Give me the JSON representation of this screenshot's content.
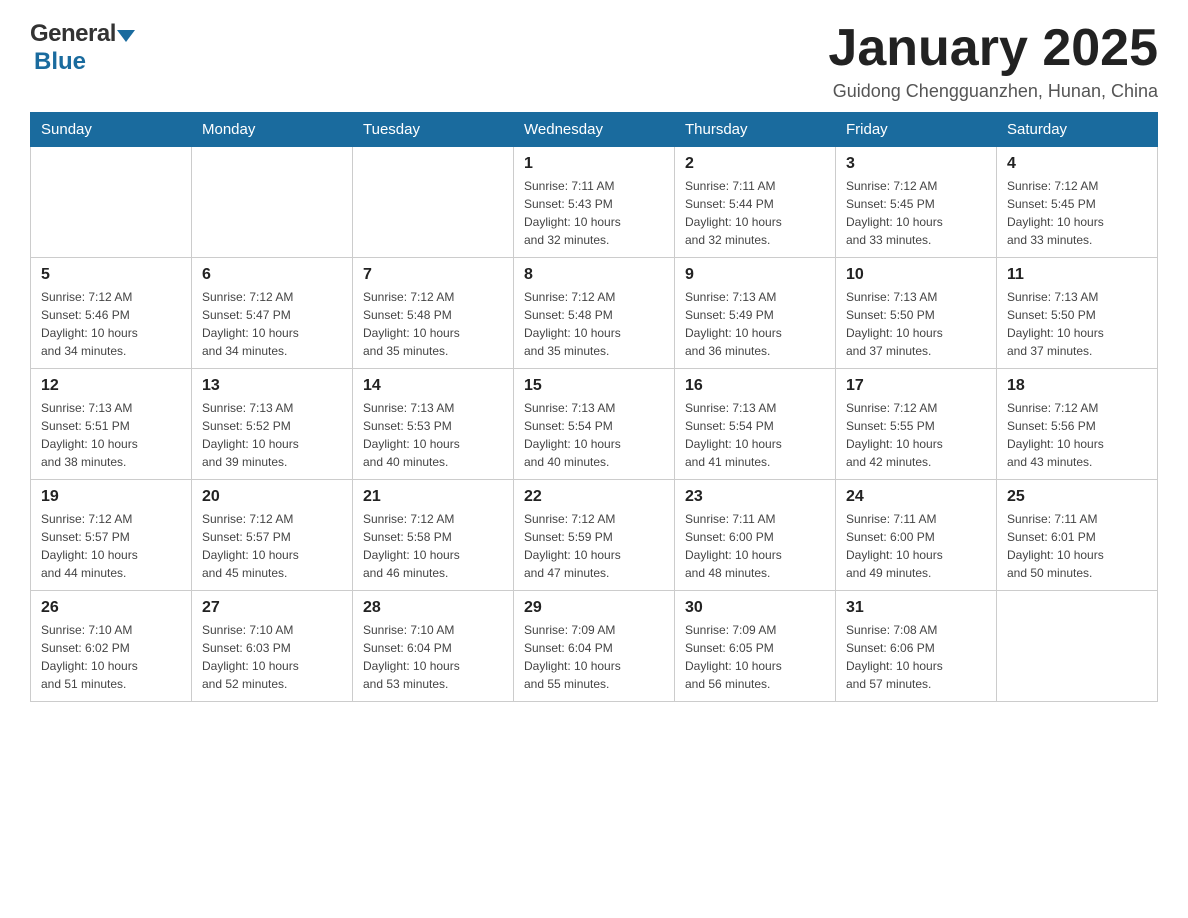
{
  "header": {
    "logo": {
      "general": "General",
      "blue": "Blue"
    },
    "title": "January 2025",
    "location": "Guidong Chengguanzhen, Hunan, China"
  },
  "days_of_week": [
    "Sunday",
    "Monday",
    "Tuesday",
    "Wednesday",
    "Thursday",
    "Friday",
    "Saturday"
  ],
  "weeks": [
    [
      {
        "day": "",
        "info": ""
      },
      {
        "day": "",
        "info": ""
      },
      {
        "day": "",
        "info": ""
      },
      {
        "day": "1",
        "info": "Sunrise: 7:11 AM\nSunset: 5:43 PM\nDaylight: 10 hours\nand 32 minutes."
      },
      {
        "day": "2",
        "info": "Sunrise: 7:11 AM\nSunset: 5:44 PM\nDaylight: 10 hours\nand 32 minutes."
      },
      {
        "day": "3",
        "info": "Sunrise: 7:12 AM\nSunset: 5:45 PM\nDaylight: 10 hours\nand 33 minutes."
      },
      {
        "day": "4",
        "info": "Sunrise: 7:12 AM\nSunset: 5:45 PM\nDaylight: 10 hours\nand 33 minutes."
      }
    ],
    [
      {
        "day": "5",
        "info": "Sunrise: 7:12 AM\nSunset: 5:46 PM\nDaylight: 10 hours\nand 34 minutes."
      },
      {
        "day": "6",
        "info": "Sunrise: 7:12 AM\nSunset: 5:47 PM\nDaylight: 10 hours\nand 34 minutes."
      },
      {
        "day": "7",
        "info": "Sunrise: 7:12 AM\nSunset: 5:48 PM\nDaylight: 10 hours\nand 35 minutes."
      },
      {
        "day": "8",
        "info": "Sunrise: 7:12 AM\nSunset: 5:48 PM\nDaylight: 10 hours\nand 35 minutes."
      },
      {
        "day": "9",
        "info": "Sunrise: 7:13 AM\nSunset: 5:49 PM\nDaylight: 10 hours\nand 36 minutes."
      },
      {
        "day": "10",
        "info": "Sunrise: 7:13 AM\nSunset: 5:50 PM\nDaylight: 10 hours\nand 37 minutes."
      },
      {
        "day": "11",
        "info": "Sunrise: 7:13 AM\nSunset: 5:50 PM\nDaylight: 10 hours\nand 37 minutes."
      }
    ],
    [
      {
        "day": "12",
        "info": "Sunrise: 7:13 AM\nSunset: 5:51 PM\nDaylight: 10 hours\nand 38 minutes."
      },
      {
        "day": "13",
        "info": "Sunrise: 7:13 AM\nSunset: 5:52 PM\nDaylight: 10 hours\nand 39 minutes."
      },
      {
        "day": "14",
        "info": "Sunrise: 7:13 AM\nSunset: 5:53 PM\nDaylight: 10 hours\nand 40 minutes."
      },
      {
        "day": "15",
        "info": "Sunrise: 7:13 AM\nSunset: 5:54 PM\nDaylight: 10 hours\nand 40 minutes."
      },
      {
        "day": "16",
        "info": "Sunrise: 7:13 AM\nSunset: 5:54 PM\nDaylight: 10 hours\nand 41 minutes."
      },
      {
        "day": "17",
        "info": "Sunrise: 7:12 AM\nSunset: 5:55 PM\nDaylight: 10 hours\nand 42 minutes."
      },
      {
        "day": "18",
        "info": "Sunrise: 7:12 AM\nSunset: 5:56 PM\nDaylight: 10 hours\nand 43 minutes."
      }
    ],
    [
      {
        "day": "19",
        "info": "Sunrise: 7:12 AM\nSunset: 5:57 PM\nDaylight: 10 hours\nand 44 minutes."
      },
      {
        "day": "20",
        "info": "Sunrise: 7:12 AM\nSunset: 5:57 PM\nDaylight: 10 hours\nand 45 minutes."
      },
      {
        "day": "21",
        "info": "Sunrise: 7:12 AM\nSunset: 5:58 PM\nDaylight: 10 hours\nand 46 minutes."
      },
      {
        "day": "22",
        "info": "Sunrise: 7:12 AM\nSunset: 5:59 PM\nDaylight: 10 hours\nand 47 minutes."
      },
      {
        "day": "23",
        "info": "Sunrise: 7:11 AM\nSunset: 6:00 PM\nDaylight: 10 hours\nand 48 minutes."
      },
      {
        "day": "24",
        "info": "Sunrise: 7:11 AM\nSunset: 6:00 PM\nDaylight: 10 hours\nand 49 minutes."
      },
      {
        "day": "25",
        "info": "Sunrise: 7:11 AM\nSunset: 6:01 PM\nDaylight: 10 hours\nand 50 minutes."
      }
    ],
    [
      {
        "day": "26",
        "info": "Sunrise: 7:10 AM\nSunset: 6:02 PM\nDaylight: 10 hours\nand 51 minutes."
      },
      {
        "day": "27",
        "info": "Sunrise: 7:10 AM\nSunset: 6:03 PM\nDaylight: 10 hours\nand 52 minutes."
      },
      {
        "day": "28",
        "info": "Sunrise: 7:10 AM\nSunset: 6:04 PM\nDaylight: 10 hours\nand 53 minutes."
      },
      {
        "day": "29",
        "info": "Sunrise: 7:09 AM\nSunset: 6:04 PM\nDaylight: 10 hours\nand 55 minutes."
      },
      {
        "day": "30",
        "info": "Sunrise: 7:09 AM\nSunset: 6:05 PM\nDaylight: 10 hours\nand 56 minutes."
      },
      {
        "day": "31",
        "info": "Sunrise: 7:08 AM\nSunset: 6:06 PM\nDaylight: 10 hours\nand 57 minutes."
      },
      {
        "day": "",
        "info": ""
      }
    ]
  ]
}
